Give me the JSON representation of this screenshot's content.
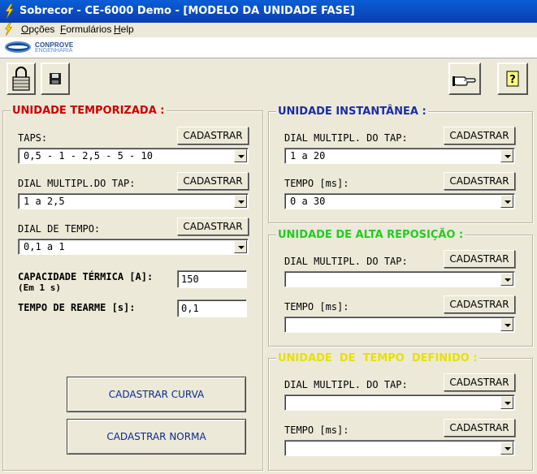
{
  "window": {
    "title": "Sobrecor - CE-6000 Demo - [MODELO DA UNIDADE FASE]"
  },
  "menu": {
    "items": [
      "Opções",
      "Formulários",
      "Help"
    ]
  },
  "logo": {
    "line1": "CONPROVE",
    "line2": "ENGENHARIA"
  },
  "toolbar": {
    "icons": [
      "lock-icon",
      "save-disk-icon",
      "pointing-hand-icon",
      "help-icon"
    ]
  },
  "common": {
    "register_label": "CADASTRAR"
  },
  "temporizada": {
    "title": "UNIDADE TEMPORIZADA :",
    "title_color": "#cc0000",
    "taps_label": "TAPS:",
    "taps_value": "0,5 - 1 - 2,5 - 5 - 10",
    "dial_tap_label": "DIAL MULTIPL.DO TAP:",
    "dial_tap_value": "1 a 2,5",
    "dial_tempo_label": "DIAL DE TEMPO:",
    "dial_tempo_value": "0,1 a 1",
    "capacidade_label": "CAPACIDADE TÉRMICA [A]:",
    "capacidade_sublabel": "(Em 1 s)",
    "capacidade_value": "150",
    "rearme_label": "TEMPO DE REARME [s]:",
    "rearme_value": "0,1",
    "curva_button": "CADASTRAR CURVA",
    "norma_button": "CADASTRAR NORMA"
  },
  "instantanea": {
    "title": "UNIDADE  INSTANTÂNEA :",
    "title_color": "#1a2ea0",
    "dial_label": "DIAL MULTIPL. DO TAP:",
    "dial_value": "1 a 20",
    "tempo_label": "TEMPO [ms]:",
    "tempo_value": "0 a 30"
  },
  "alta_reposicao": {
    "title": "UNIDADE DE ALTA REPOSIÇÃO :",
    "title_color": "#22cc22",
    "dial_label": "DIAL MULTIPL. DO TAP:",
    "dial_value": "",
    "tempo_label": "TEMPO [ms]:",
    "tempo_value": ""
  },
  "tempo_definido": {
    "title": "UNIDADE  DE  TEMPO  DEFINIDO :",
    "title_color": "#e8e000",
    "dial_label": "DIAL MULTIPL. DO TAP:",
    "dial_value": "",
    "tempo_label": "TEMPO [ms]:",
    "tempo_value": ""
  }
}
